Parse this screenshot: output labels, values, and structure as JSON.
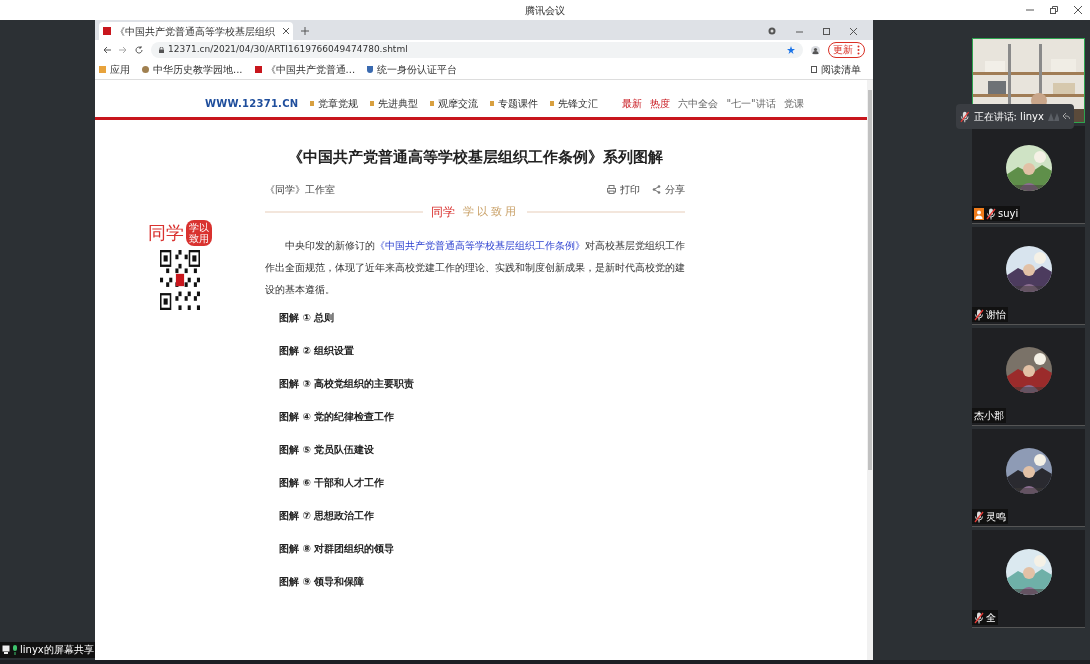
{
  "window": {
    "title": "腾讯会议"
  },
  "browser": {
    "tab_title": "《中国共产党普通高等学校基层组织",
    "url": "12371.cn/2021/04/30/ARTI1619766049474780.shtml",
    "update_button": "更新",
    "bookmarks": [
      "应用",
      "中华历史教学园地...",
      "《中国共产党普通...",
      "统一身份认证平台"
    ],
    "reading_list": "阅读清单"
  },
  "site": {
    "domain": "WWW.12371.CN",
    "nav": [
      "党章党规",
      "先进典型",
      "观摩交流",
      "专题课件",
      "先锋文汇"
    ],
    "quick_links": [
      {
        "label": "最新",
        "highlight": true
      },
      {
        "label": "热度",
        "highlight": true
      },
      {
        "label": "六中全会",
        "highlight": false
      },
      {
        "label": "\"七一\"讲话",
        "highlight": false
      },
      {
        "label": "党课",
        "highlight": false
      }
    ]
  },
  "side_logo": {
    "name": "同学",
    "badge_top": "学以",
    "badge_bottom": "致用"
  },
  "article": {
    "title": "《中国共产党普通高等学校基层组织工作条例》系列图解",
    "source": "《同学》工作室",
    "print": "打印",
    "share": "分享",
    "banner_name": "同学",
    "banner_motto": "学以致用",
    "intro_before": "中央印发的新修订的",
    "intro_link": "《中国共产党普通高等学校基层组织工作条例》",
    "intro_after": "对高校基层党组织工作作出全面规范，体现了近年来高校党建工作的理论、实践和制度创新成果，是新时代高校党的建设的基本遵循。",
    "items": [
      "图解 ① 总则",
      "图解 ② 组织设置",
      "图解 ③ 高校党组织的主要职责",
      "图解 ④ 党的纪律检查工作",
      "图解 ⑤ 党员队伍建设",
      "图解 ⑥ 干部和人才工作",
      "图解 ⑦ 思想政治工作",
      "图解 ⑧ 对群团组织的领导",
      "图解 ⑨ 领导和保障"
    ]
  },
  "speaking": {
    "label": "正在讲话: linyx"
  },
  "participants": [
    {
      "name": "suyi",
      "muted": true,
      "host": true
    },
    {
      "name": "谢怡",
      "muted": true,
      "host": false
    },
    {
      "name": "杰小郡",
      "muted": false,
      "host": false
    },
    {
      "name": "灵鸣",
      "muted": true,
      "host": false
    },
    {
      "name": "全",
      "muted": true,
      "host": false
    }
  ],
  "share_label": "linyx的屏幕共享"
}
